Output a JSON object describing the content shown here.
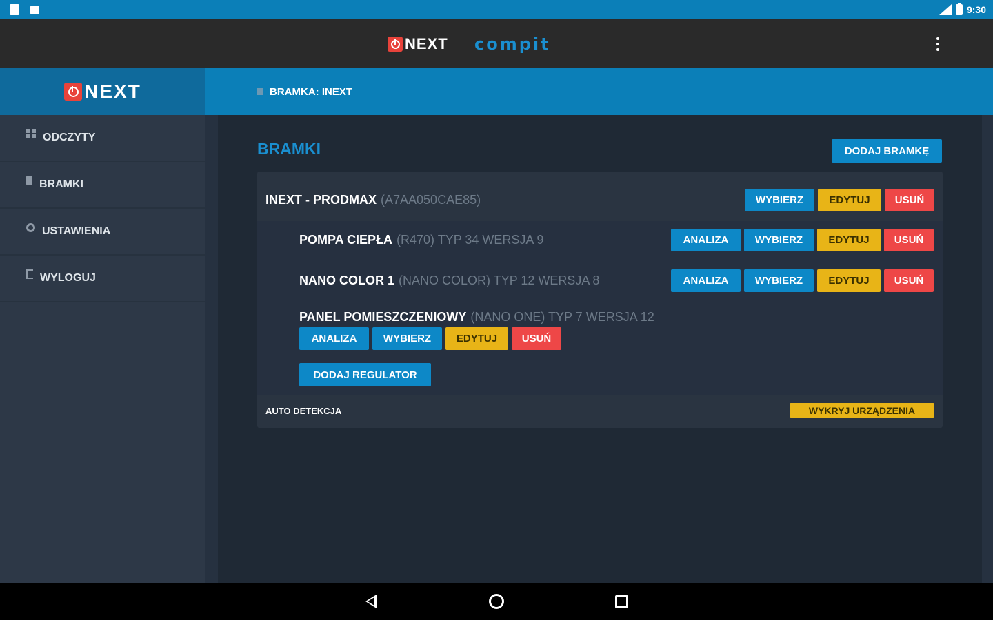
{
  "status_bar": {
    "time": "9:30"
  },
  "app_bar": {
    "brand_left": "NEXT",
    "brand_right": "compit"
  },
  "sidebar": {
    "logo_text": "NEXT",
    "items": [
      {
        "label": "ODCZYTY",
        "icon": "grid-icon"
      },
      {
        "label": "BRAMKI",
        "icon": "device-icon"
      },
      {
        "label": "USTAWIENIA",
        "icon": "gear-icon"
      },
      {
        "label": "WYLOGUJ",
        "icon": "logout-icon"
      }
    ]
  },
  "breadcrumb": {
    "text": "BRAMKA: INEXT"
  },
  "main": {
    "title": "BRAMKI",
    "add_gateway_label": "DODAJ BRAMKĘ",
    "gateway": {
      "name": "INEXT - PRODMAX",
      "id": "(A7AA050CAE85)",
      "select_label": "WYBIERZ",
      "edit_label": "EDYTUJ",
      "delete_label": "USUŃ"
    },
    "regulators": [
      {
        "name": "POMPA CIEPŁA",
        "details": "(R470) TYP 34 WERSJA 9",
        "analysis_label": "ANALIZA",
        "select_label": "WYBIERZ",
        "edit_label": "EDYTUJ",
        "delete_label": "USUŃ"
      },
      {
        "name": "NANO COLOR 1",
        "details": "(NANO COLOR) TYP 12 WERSJA 8",
        "analysis_label": "ANALIZA",
        "select_label": "WYBIERZ",
        "edit_label": "EDYTUJ",
        "delete_label": "USUŃ"
      },
      {
        "name": "PANEL POMIESZCZENIOWY",
        "details": "(NANO ONE) TYP 7 WERSJA 12",
        "analysis_label": "ANALIZA",
        "select_label": "WYBIERZ",
        "edit_label": "EDYTUJ",
        "delete_label": "USUŃ"
      }
    ],
    "add_regulator_label": "DODAJ REGULATOR",
    "auto_detect_label": "AUTO DETEKCJA",
    "detect_devices_label": "WYKRYJ URZĄDZENIA"
  },
  "colors": {
    "accent": "#0b7fb8",
    "edit": "#e8b417",
    "delete": "#ee4747"
  }
}
